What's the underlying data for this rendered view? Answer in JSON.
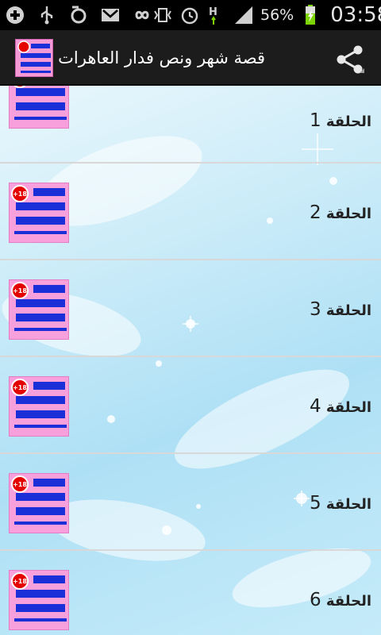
{
  "status_bar": {
    "icons": [
      "add-icon",
      "usb-icon",
      "sync-icon",
      "gmail-icon",
      "infinity-icon",
      "vibrate-icon",
      "alarm-icon",
      "network-h-icon",
      "signal-icon",
      "battery-charging-icon"
    ],
    "network_label": "H",
    "battery_percent": "56%",
    "time": "03:58"
  },
  "action_bar": {
    "title": "قصة شهر ونص فدار العاهرات",
    "share_icon": "share-icon"
  },
  "list": {
    "items": [
      {
        "label": "الحلقة",
        "number": "1"
      },
      {
        "label": "الحلقة",
        "number": "2"
      },
      {
        "label": "الحلقة",
        "number": "3"
      },
      {
        "label": "الحلقة",
        "number": "4"
      },
      {
        "label": "الحلقة",
        "number": "5"
      },
      {
        "label": "الحلقة",
        "number": "6"
      }
    ],
    "thumb_badge": "+18",
    "thumb_lines": [
      "قصة",
      "شهر ونص",
      "فدار القحاب"
    ]
  },
  "colors": {
    "action_bar_bg": "#1c1c1c",
    "thumb_bg": "#f7a0dc",
    "badge_red": "#e50000",
    "list_bg": "#c7eaf8"
  }
}
